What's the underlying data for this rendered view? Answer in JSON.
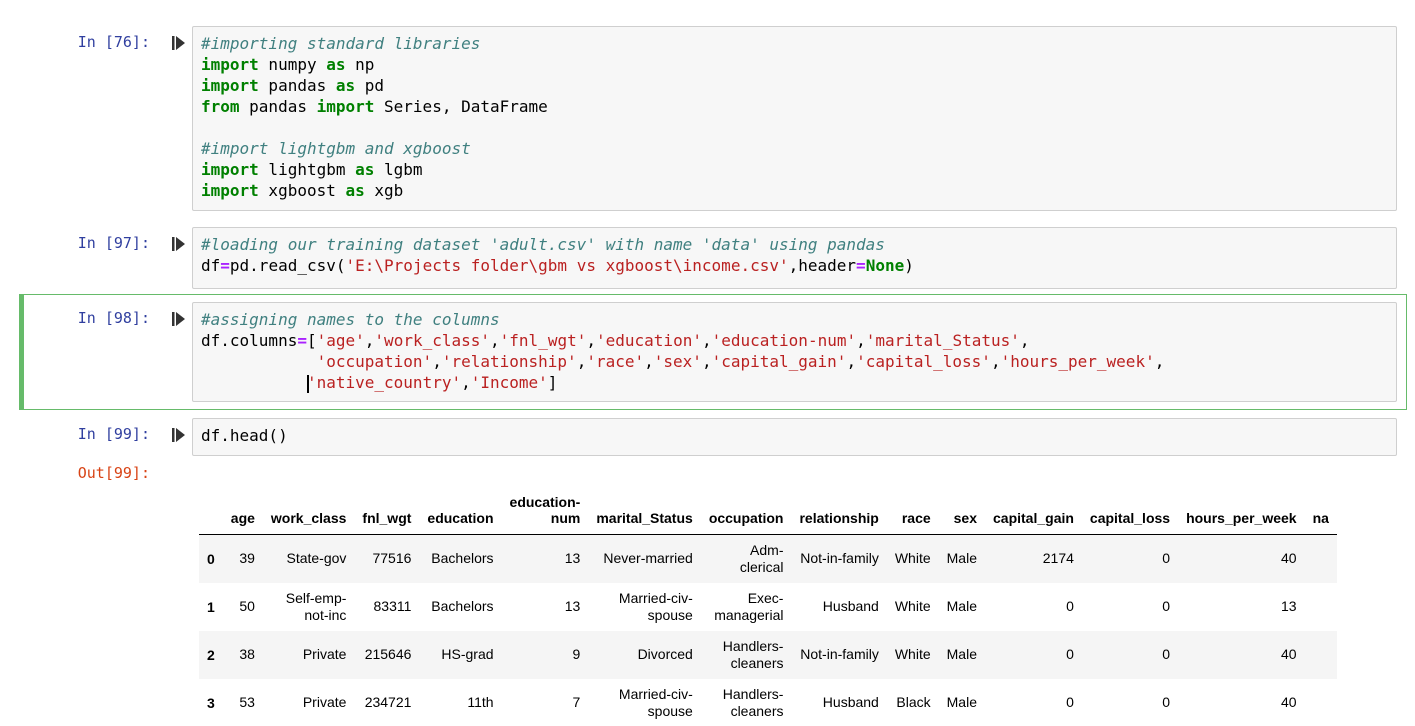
{
  "cells": [
    {
      "prompt": "In [76]:",
      "lines": [
        [
          [
            "c",
            "#importing standard libraries"
          ]
        ],
        [
          [
            "k",
            "import"
          ],
          [
            "t",
            " numpy "
          ],
          [
            "k",
            "as"
          ],
          [
            "t",
            " np"
          ]
        ],
        [
          [
            "k",
            "import"
          ],
          [
            "t",
            " pandas "
          ],
          [
            "k",
            "as"
          ],
          [
            "t",
            " pd"
          ]
        ],
        [
          [
            "k",
            "from"
          ],
          [
            "t",
            " pandas "
          ],
          [
            "k",
            "import"
          ],
          [
            "t",
            " Series, DataFrame"
          ]
        ],
        [],
        [
          [
            "c",
            "#import lightgbm and xgboost"
          ]
        ],
        [
          [
            "k",
            "import"
          ],
          [
            "t",
            " lightgbm "
          ],
          [
            "k",
            "as"
          ],
          [
            "t",
            " lgbm"
          ]
        ],
        [
          [
            "k",
            "import"
          ],
          [
            "t",
            " xgboost "
          ],
          [
            "k",
            "as"
          ],
          [
            "t",
            " xgb"
          ]
        ]
      ]
    },
    {
      "prompt": "In [97]:",
      "lines": [
        [
          [
            "c",
            "#loading our training dataset 'adult.csv' with name 'data' using pandas"
          ]
        ],
        [
          [
            "t",
            "df"
          ],
          [
            "o",
            "="
          ],
          [
            "t",
            "pd.read_csv("
          ],
          [
            "s",
            "'E:\\Projects folder\\gbm vs xgboost\\income.csv'"
          ],
          [
            "t",
            ",header"
          ],
          [
            "o",
            "="
          ],
          [
            "k",
            "None"
          ],
          [
            "t",
            ")"
          ]
        ]
      ]
    },
    {
      "prompt": "In [98]:",
      "lines": [
        [
          [
            "c",
            "#assigning names to the columns"
          ]
        ],
        [
          [
            "t",
            "df.columns"
          ],
          [
            "o",
            "="
          ],
          [
            "t",
            "["
          ],
          [
            "s",
            "'age'"
          ],
          [
            "t",
            ","
          ],
          [
            "s",
            "'work_class'"
          ],
          [
            "t",
            ","
          ],
          [
            "s",
            "'fnl_wgt'"
          ],
          [
            "t",
            ","
          ],
          [
            "s",
            "'education'"
          ],
          [
            "t",
            ","
          ],
          [
            "s",
            "'education-num'"
          ],
          [
            "t",
            ","
          ],
          [
            "s",
            "'marital_Status'"
          ],
          [
            "t",
            ","
          ]
        ],
        [
          [
            "t",
            "            "
          ],
          [
            "s",
            "'occupation'"
          ],
          [
            "t",
            ","
          ],
          [
            "s",
            "'relationship'"
          ],
          [
            "t",
            ","
          ],
          [
            "s",
            "'race'"
          ],
          [
            "t",
            ","
          ],
          [
            "s",
            "'sex'"
          ],
          [
            "t",
            ","
          ],
          [
            "s",
            "'capital_gain'"
          ],
          [
            "t",
            ","
          ],
          [
            "s",
            "'capital_loss'"
          ],
          [
            "t",
            ","
          ],
          [
            "s",
            "'hours_per_week'"
          ],
          [
            "t",
            ","
          ]
        ],
        [
          [
            "t",
            "           "
          ],
          [
            "cursor",
            ""
          ],
          [
            "s",
            "'native_country'"
          ],
          [
            "t",
            ","
          ],
          [
            "s",
            "'Income'"
          ],
          [
            "t",
            "]"
          ]
        ]
      ]
    },
    {
      "prompt": "In [99]:",
      "lines": [
        [
          [
            "t",
            "df.head()"
          ]
        ]
      ]
    }
  ],
  "output": {
    "prompt": "Out[99]:",
    "columns": [
      "",
      "age",
      "work_class",
      "fnl_wgt",
      "education",
      "education-\nnum",
      "marital_Status",
      "occupation",
      "relationship",
      "race",
      "sex",
      "capital_gain",
      "capital_loss",
      "hours_per_week",
      "na"
    ],
    "rows": [
      [
        "0",
        "39",
        "State-gov",
        "77516",
        "Bachelors",
        "13",
        "Never-married",
        "Adm-\nclerical",
        "Not-in-family",
        "White",
        "Male",
        "2174",
        "0",
        "40",
        ""
      ],
      [
        "1",
        "50",
        "Self-emp-\nnot-inc",
        "83311",
        "Bachelors",
        "13",
        "Married-civ-\nspouse",
        "Exec-\nmanagerial",
        "Husband",
        "White",
        "Male",
        "0",
        "0",
        "13",
        ""
      ],
      [
        "2",
        "38",
        "Private",
        "215646",
        "HS-grad",
        "9",
        "Divorced",
        "Handlers-\ncleaners",
        "Not-in-family",
        "White",
        "Male",
        "0",
        "0",
        "40",
        ""
      ],
      [
        "3",
        "53",
        "Private",
        "234721",
        "11th",
        "7",
        "Married-civ-\nspouse",
        "Handlers-\ncleaners",
        "Husband",
        "Black",
        "Male",
        "0",
        "0",
        "40",
        ""
      ]
    ]
  },
  "colors": {
    "in_prompt": "#303F9F",
    "out_prompt": "#D84315",
    "selected_border": "#66BB6A",
    "comment": "#408080",
    "keyword": "#008000",
    "string": "#BA2121",
    "operator": "#AA22FF"
  },
  "icons": {
    "run": "run-cell-icon"
  }
}
